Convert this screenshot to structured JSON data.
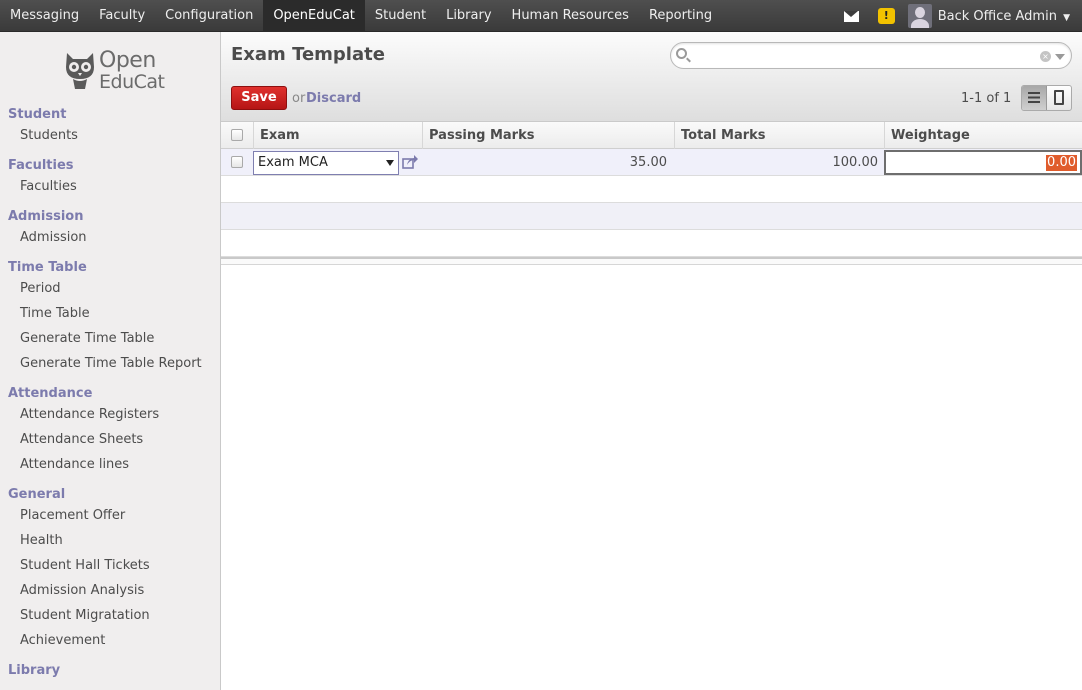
{
  "top_menu": [
    "Messaging",
    "Faculty",
    "Configuration",
    "OpenEduCat",
    "Student",
    "Library",
    "Human Resources",
    "Reporting"
  ],
  "active_menu": "OpenEduCat",
  "user": {
    "name": "Back Office Admin",
    "caret": "▼"
  },
  "warning_badge": "!",
  "logo": {
    "line1": "Open",
    "line2": "EduCat"
  },
  "sidebar": {
    "sections": [
      {
        "title": "Student",
        "items": [
          "Students"
        ]
      },
      {
        "title": "Faculties",
        "items": [
          "Faculties"
        ]
      },
      {
        "title": "Admission",
        "items": [
          "Admission"
        ]
      },
      {
        "title": "Time Table",
        "items": [
          "Period",
          "Time Table",
          "Generate Time Table",
          "Generate Time Table Report"
        ]
      },
      {
        "title": "Attendance",
        "items": [
          "Attendance Registers",
          "Attendance Sheets",
          "Attendance lines"
        ]
      },
      {
        "title": "General",
        "items": [
          "Placement Offer",
          "Health",
          "Student Hall Tickets",
          "Admission Analysis",
          "Student Migratation",
          "Achievement"
        ]
      },
      {
        "title": "Library",
        "items": []
      }
    ]
  },
  "page": {
    "title": "Exam Template",
    "save_label": "Save",
    "or_label": "or",
    "discard_label": "Discard",
    "pager": "1-1 of 1",
    "search_value": ""
  },
  "table": {
    "columns": [
      "Exam",
      "Passing Marks",
      "Total Marks",
      "Weightage"
    ],
    "rows": [
      {
        "exam": "Exam MCA",
        "passing_marks": "35.00",
        "total_marks": "100.00",
        "weightage": "0.00"
      }
    ]
  },
  "colors": {
    "accent": "#7c7bad",
    "save": "#c9201c",
    "selection": "#e05c2c"
  }
}
